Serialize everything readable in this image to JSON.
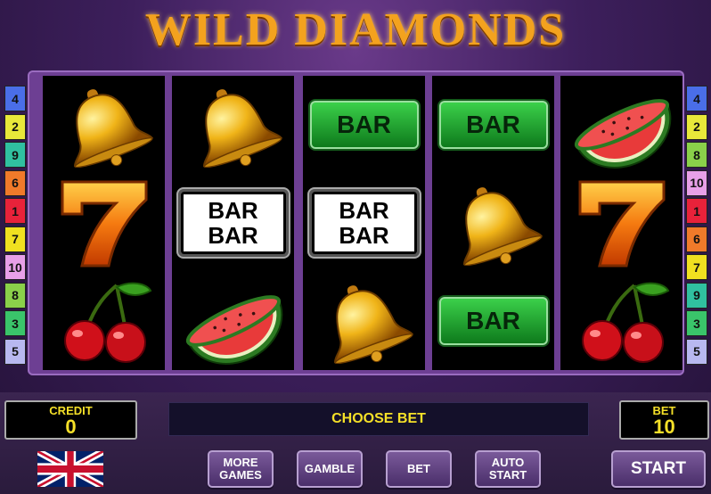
{
  "title": "WILD DIAMONDS",
  "left_lines": [
    "4",
    "2",
    "9",
    "6",
    "1",
    "7",
    "10",
    "8",
    "3",
    "5"
  ],
  "right_lines": [
    "4",
    "2",
    "8",
    "10",
    "1",
    "6",
    "7",
    "9",
    "3",
    "5"
  ],
  "line_colors": {
    "1": "#e8223a",
    "2": "#e8e83a",
    "3": "#3ac46a",
    "4": "#4a6ee8",
    "5": "#b8b8f0",
    "6": "#f07a2a",
    "7": "#f0e020",
    "8": "#8ad04a",
    "9": "#30c0a0",
    "10": "#e8a0e8"
  },
  "reels": [
    [
      "bell",
      "seven",
      "cherries"
    ],
    [
      "bell",
      "bar-bar",
      "watermelon"
    ],
    [
      "bar",
      "bar-bar",
      "bell"
    ],
    [
      "bar",
      "bell",
      "bar"
    ],
    [
      "watermelon",
      "seven",
      "cherries"
    ]
  ],
  "bar_text": "BAR",
  "credit": {
    "label": "CREDIT",
    "value": "0"
  },
  "bet": {
    "label": "BET",
    "value": "10"
  },
  "message": "CHOOSE BET",
  "buttons": {
    "more_games": "MORE GAMES",
    "gamble": "GAMBLE",
    "bet": "BET",
    "auto_start": "AUTO START",
    "start": "START"
  },
  "language_flag": "uk-flag-icon"
}
